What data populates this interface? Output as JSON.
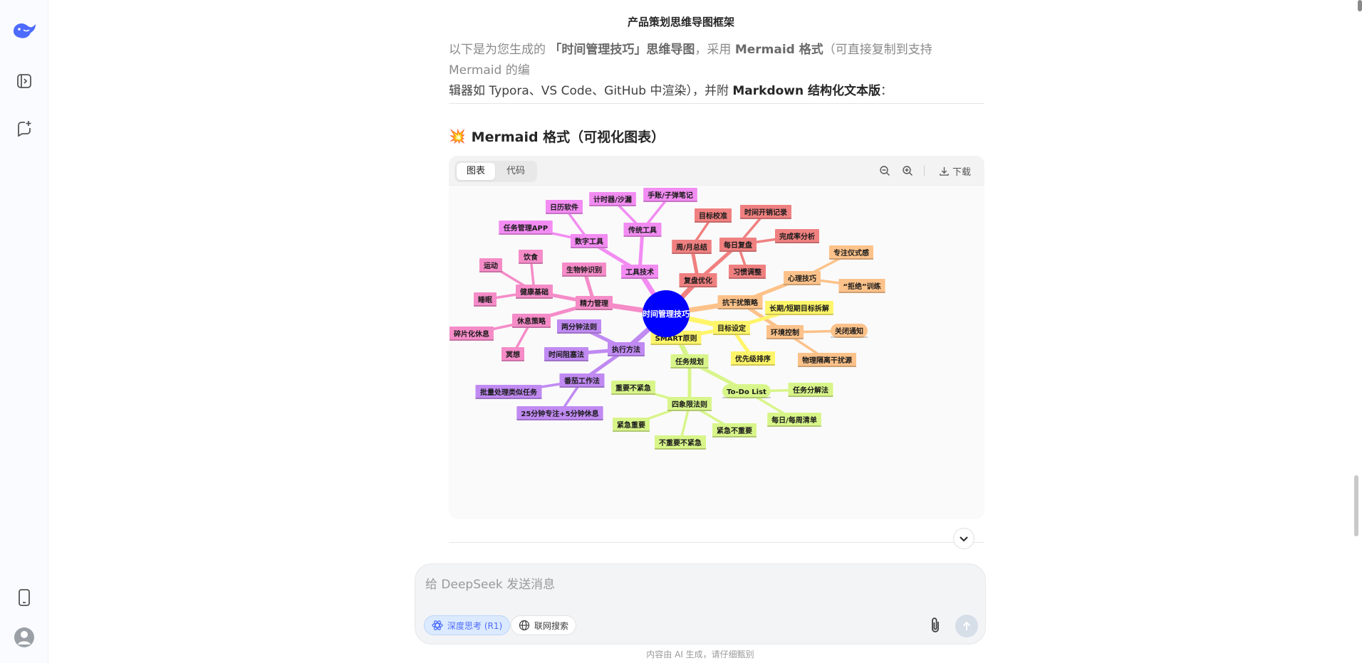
{
  "conversation_title": "产品策划思维导图框架",
  "intro": {
    "p1_pre": "以下是为您生成的 ",
    "p1_topic": "「时间管理技巧」思维导图",
    "p1_mid": "，采用 ",
    "p1_format": "Mermaid 格式",
    "p1_post": "（可直接复制到支持 Mermaid 的编",
    "p2_pre": "辑器如 Typora、VS Code、GitHub 中渲染），并附 ",
    "p2_bold": "Markdown 结构化文本版",
    "p2_post": "："
  },
  "section_heading": {
    "emoji": "💥",
    "text": "Mermaid 格式（可视化图表）"
  },
  "diagram_card": {
    "tab_chart": "图表",
    "tab_code": "代码",
    "active_tab": "图表",
    "zoom_out_icon": "zoom-out-icon",
    "zoom_in_icon": "zoom-in-icon",
    "download_label": "下载"
  },
  "mindmap": {
    "root": "时间管理技巧",
    "colors": {
      "root": "#0000ff",
      "tools": "#f28cf2",
      "review": "#f08080",
      "resist": "#fcc28a",
      "goal": "#fff56a",
      "plan": "#d8f58a",
      "exec": "#c08af2",
      "energy": "#f58cc8"
    },
    "branches": [
      {
        "key": "tools",
        "label": "工具技术",
        "children": [
          {
            "label": "数字工具",
            "children": [
              "任务管理APP",
              "日历软件"
            ]
          },
          {
            "label": "传统工具",
            "children": [
              "计时器/沙漏",
              "手账/子弹笔记"
            ]
          }
        ]
      },
      {
        "key": "review",
        "label": "复盘优化",
        "children": [
          {
            "label": "周/月总结",
            "children": [
              "目标校准"
            ]
          },
          {
            "label": "每日复盘",
            "children": [
              "时间开销记录",
              "完成率分析",
              "习惯调整"
            ]
          }
        ]
      },
      {
        "key": "resist",
        "label": "抗干扰策略",
        "children": [
          {
            "label": "心理技巧",
            "children": [
              "专注仪式感",
              "“拒绝”训练"
            ]
          },
          {
            "label": "环境控制",
            "children": [
              "关闭通知",
              "物理隔离干扰源"
            ]
          }
        ]
      },
      {
        "key": "goal",
        "label": "目标设定",
        "children": [
          {
            "label": "SMART原则",
            "children": []
          },
          {
            "label": "长期/短期目标拆解",
            "children": []
          },
          {
            "label": "优先级排序",
            "children": []
          }
        ]
      },
      {
        "key": "plan",
        "label": "任务规划",
        "children": [
          {
            "label": "To-Do List",
            "children": [
              "任务分解法",
              "每日/每周清单"
            ]
          },
          {
            "label": "四象限法则",
            "children": [
              "重要不紧急",
              "紧急重要",
              "不重要不紧急",
              "紧急不重要"
            ]
          }
        ]
      },
      {
        "key": "exec",
        "label": "执行方法",
        "children": [
          {
            "label": "两分钟法则",
            "children": []
          },
          {
            "label": "时间阻塞法",
            "children": []
          },
          {
            "label": "番茄工作法",
            "children": [
              "批量处理类似任务",
              "25分钟专注+5分钟休息"
            ]
          }
        ]
      },
      {
        "key": "energy",
        "label": "精力管理",
        "children": [
          {
            "label": "生物钟识别",
            "children": []
          },
          {
            "label": "健康基础",
            "children": [
              "运动",
              "饮食",
              "睡眠"
            ]
          },
          {
            "label": "休息策略",
            "children": [
              "碎片化休息",
              "冥想"
            ]
          }
        ]
      }
    ]
  },
  "composer": {
    "placeholder": "给 DeepSeek 发送消息",
    "deep_think_label": "深度思考 (R1)",
    "web_search_label": "联网搜索"
  },
  "disclaimer": "内容由 AI 生成，请仔细甄别"
}
